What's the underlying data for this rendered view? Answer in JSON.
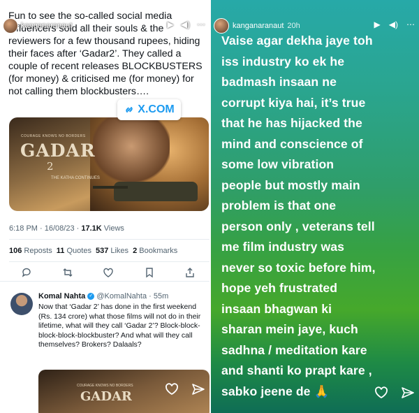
{
  "left": {
    "story": {
      "username": "kanganaranaut",
      "controls": [
        "▶",
        "◀)",
        "⋯"
      ]
    },
    "tweet_text": "Fun to see the so-called social media influencers sold all their souls & the reviewers for a few thousand rupees, hiding their faces after ‘Gadar2’. They called a couple of recent releases BLOCKBUSTERS (for money) & criticised me (for money) for not calling them blockbusters….",
    "link_sticker": {
      "icon": "link-icon",
      "label": "X.COM"
    },
    "poster": {
      "tagline": "COURAGE KNOWS NO BORDERS",
      "title": "GADAR",
      "number": "2",
      "subtitle": "THE KATHA CONTINUES"
    },
    "meta": {
      "time": "6:18 PM · 16/08/23 ·",
      "views": "17.1K",
      "views_label": "Views"
    },
    "stats": [
      {
        "count": "106",
        "label": "Reposts"
      },
      {
        "count": "11",
        "label": "Quotes"
      },
      {
        "count": "537",
        "label": "Likes"
      },
      {
        "count": "2",
        "label": "Bookmarks"
      }
    ],
    "actions": [
      "reply-icon",
      "repost-icon",
      "like-icon",
      "bookmark-icon",
      "share-icon"
    ],
    "reply": {
      "name": "Komal Nahta",
      "handle": "@KomalNahta · 55m",
      "text": "Now that ‘Gadar 2’ has done in the first weekend (Rs. 134 crore) what those films will not do in their lifetime, what will they call ‘Gadar 2’? Block-block-block-block-blockbuster? And what will they call themselves? Brokers? Dalaals?",
      "poster_tagline": "COURAGE KNOWS NO BORDERS",
      "poster_title": "GADAR"
    },
    "bottom_icons": [
      "heart-icon",
      "send-icon"
    ]
  },
  "right": {
    "story": {
      "username": "kanganaranaut",
      "time": "20h",
      "controls": [
        "▶",
        "◀)",
        "⋯"
      ]
    },
    "caption": "Vaise agar dekha jaye toh\niss industry ko ek he\nbadmash insaan ne\ncorrupt kiya hai, it’s true\nthat he has hijacked the\nmind and conscience of\nsome low vibration\npeople but mostly main\nproblem is that one\nperson only , veterans tell\nme film industry was\nnever so toxic before him,\nhope yeh frustrated\ninsaan bhagwan ki\nsharan mein jaye, kuch\nsadhna / meditation kare\nand shanti ko prapt kare ,\nsabko jeene de 🙏",
    "bottom_icons": [
      "heart-icon",
      "send-icon"
    ]
  }
}
